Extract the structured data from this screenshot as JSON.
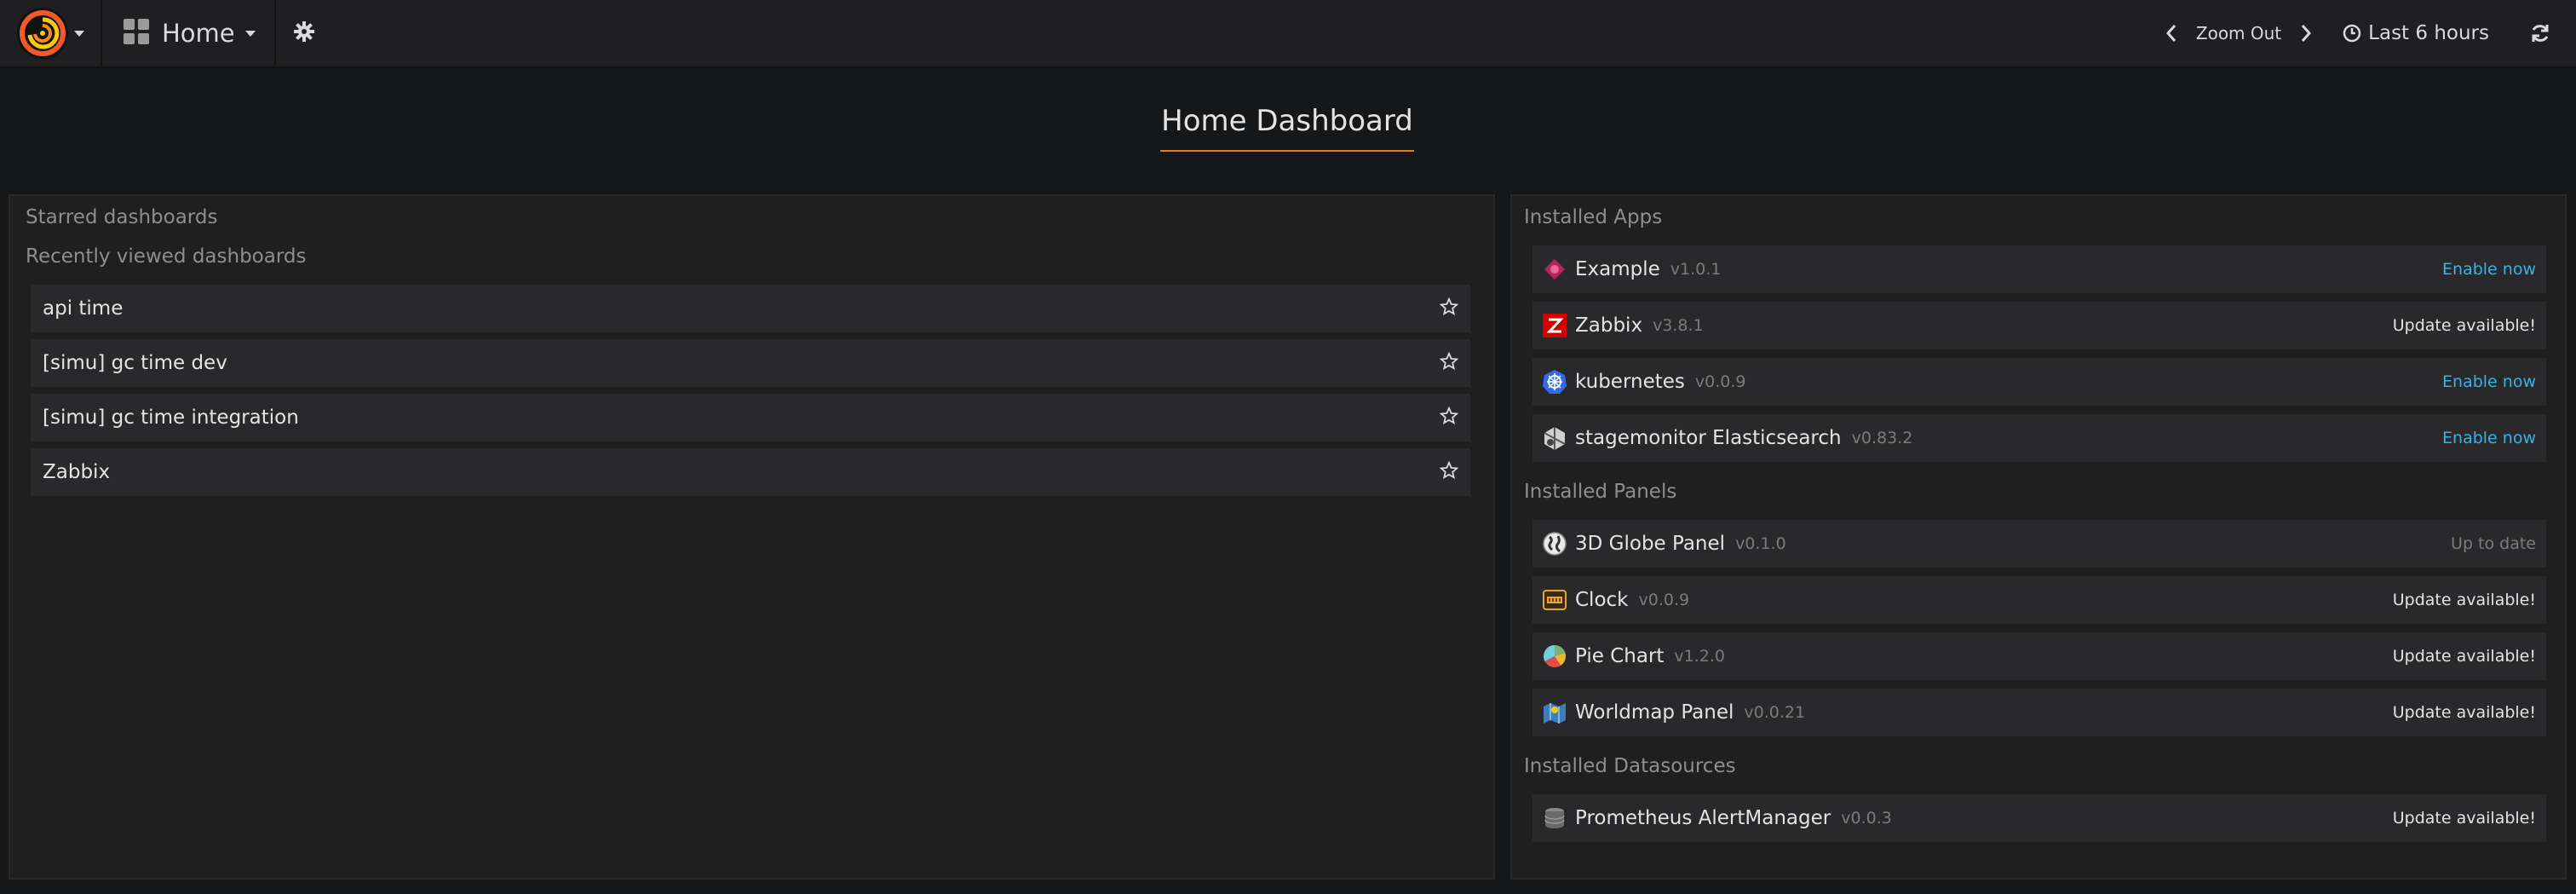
{
  "navbar": {
    "home_label": "Home",
    "zoom_label": "Zoom Out",
    "time_range": "Last 6 hours"
  },
  "title": "Home Dashboard",
  "left_panel": {
    "starred_heading": "Starred dashboards",
    "recent_heading": "Recently viewed dashboards",
    "recent": [
      {
        "name": "api time"
      },
      {
        "name": "[simu] gc time dev"
      },
      {
        "name": "[simu] gc time integration"
      },
      {
        "name": "Zabbix"
      }
    ]
  },
  "right_panel": {
    "apps_heading": "Installed Apps",
    "apps": [
      {
        "name": "Example",
        "version": "v1.0.1",
        "status": "Enable now",
        "icon": "example-app-icon"
      },
      {
        "name": "Zabbix",
        "version": "v3.8.1",
        "status": "Update available!",
        "icon": "zabbix-icon"
      },
      {
        "name": "kubernetes",
        "version": "v0.0.9",
        "status": "Enable now",
        "icon": "kubernetes-icon"
      },
      {
        "name": "stagemonitor Elasticsearch",
        "version": "v0.83.2",
        "status": "Enable now",
        "icon": "stagemonitor-icon"
      }
    ],
    "panels_heading": "Installed Panels",
    "panels": [
      {
        "name": "3D Globe Panel",
        "version": "v0.1.0",
        "status": "Up to date",
        "icon": "globe-icon"
      },
      {
        "name": "Clock",
        "version": "v0.0.9",
        "status": "Update available!",
        "icon": "clock-icon"
      },
      {
        "name": "Pie Chart",
        "version": "v1.2.0",
        "status": "Update available!",
        "icon": "pie-chart-icon"
      },
      {
        "name": "Worldmap Panel",
        "version": "v0.0.21",
        "status": "Update available!",
        "icon": "worldmap-icon"
      }
    ],
    "datasources_heading": "Installed Datasources",
    "datasources": [
      {
        "name": "Prometheus AlertManager",
        "version": "v0.0.3",
        "status": "Update available!",
        "icon": "database-icon"
      }
    ]
  },
  "colors": {
    "background": "#161719",
    "panel": "#1f1f20",
    "row": "#29292b",
    "accent": "#eb7b18",
    "link": "#33b5e5"
  }
}
